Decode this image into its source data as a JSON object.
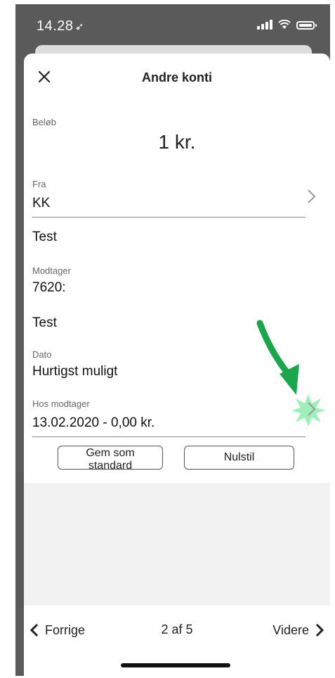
{
  "status_bar": {
    "time": "14.28",
    "location_glyph": "➶"
  },
  "header": {
    "title": "Andre konti",
    "close_icon": "close-icon"
  },
  "form": {
    "amount": {
      "label": "Beløb",
      "value": "1 kr."
    },
    "from": {
      "label": "Fra",
      "value": "KK"
    },
    "from_text": "Test",
    "recipient": {
      "label": "Modtager",
      "value": "7620:"
    },
    "recipient_text": "Test",
    "date": {
      "label": "Dato",
      "value": "Hurtigst muligt"
    },
    "at_recipient": {
      "label": "Hos modtager",
      "value": "13.02.2020 - 0,00 kr."
    }
  },
  "buttons": {
    "save_default": "Gem som standard",
    "reset": "Nulstil"
  },
  "footer": {
    "previous": "Forrige",
    "page": "2 af 5",
    "next": "Videre"
  },
  "colors": {
    "annotation_arrow": "#1aa64a",
    "annotation_burst": "#9ff0b8",
    "frame": "#5a5a5a"
  }
}
